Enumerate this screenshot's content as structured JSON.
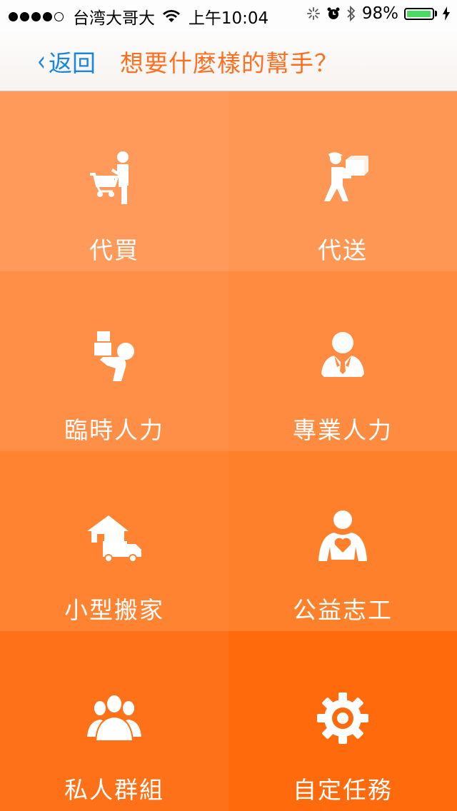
{
  "status_bar": {
    "carrier": "台湾大哥大",
    "time": "上午10:04",
    "battery": "98%",
    "battery_level": 0.98
  },
  "nav": {
    "back_label": "返回",
    "title": "想要什麼樣的幫手？"
  },
  "tiles": [
    {
      "label": "代買",
      "icon": "shopping-cart-person-icon",
      "color": "#ff9a5a"
    },
    {
      "label": "代送",
      "icon": "delivery-person-icon",
      "color": "#ff9754"
    },
    {
      "label": "臨時人力",
      "icon": "carrying-boxes-person-icon",
      "color": "#ff8e46"
    },
    {
      "label": "專業人力",
      "icon": "businessman-icon",
      "color": "#ff8b40"
    },
    {
      "label": "小型搬家",
      "icon": "house-truck-icon",
      "color": "#ff8331"
    },
    {
      "label": "公益志工",
      "icon": "volunteer-heart-icon",
      "color": "#ff802b"
    },
    {
      "label": "私人群組",
      "icon": "group-people-icon",
      "color": "#ff7118"
    },
    {
      "label": "自定任務",
      "icon": "gear-icon",
      "color": "#ff6a0c"
    }
  ]
}
